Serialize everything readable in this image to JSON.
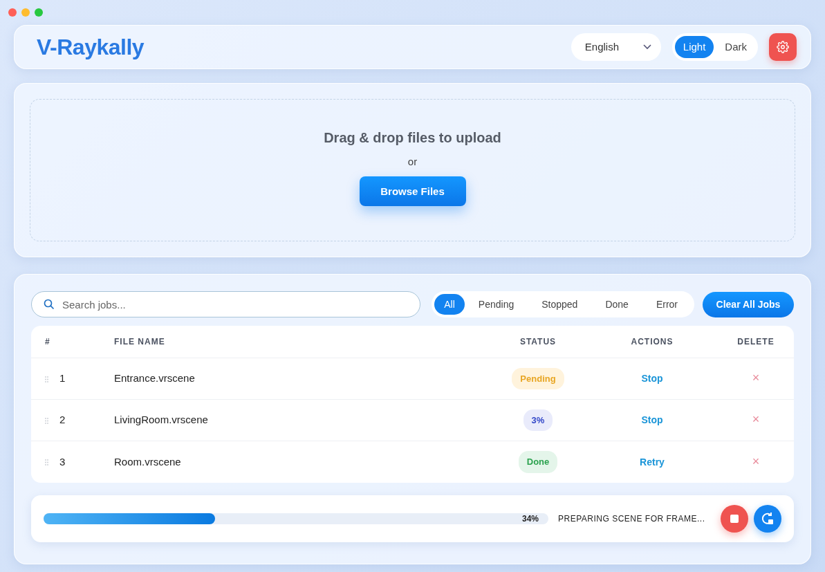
{
  "app": {
    "title": "V-Raykally"
  },
  "language": {
    "value": "English"
  },
  "theme_toggle": [
    {
      "label": "Light",
      "selected": true
    },
    {
      "label": "Dark",
      "selected": false
    }
  ],
  "upload": {
    "heading": "Drag & drop files to upload",
    "separator": "or",
    "button": "Browse Files"
  },
  "search": {
    "placeholder": "Search jobs..."
  },
  "filters": [
    {
      "label": "All",
      "selected": true
    },
    {
      "label": "Pending",
      "selected": false
    },
    {
      "label": "Stopped",
      "selected": false
    },
    {
      "label": "Done",
      "selected": false
    },
    {
      "label": "Error",
      "selected": false
    }
  ],
  "clear_button": "Clear All Jobs",
  "table": {
    "columns": [
      "#",
      "FILE NAME",
      "STATUS",
      "ACTIONS",
      "DELETE"
    ],
    "rows": [
      {
        "index": "1",
        "file": "Entrance.vrscene",
        "status": {
          "kind": "pending",
          "text": "Pending"
        },
        "action": "Stop",
        "delete": "×"
      },
      {
        "index": "2",
        "file": "LivingRoom.vrscene",
        "status": {
          "kind": "progress",
          "text": "3%"
        },
        "action": "Stop",
        "delete": "×"
      },
      {
        "index": "3",
        "file": "Room.vrscene",
        "status": {
          "kind": "done",
          "text": "Done"
        },
        "action": "Retry",
        "delete": "×"
      }
    ]
  },
  "progress": {
    "level": 0.34,
    "reading": "34%",
    "message": "PREPARING SCENE FOR FRAME..."
  }
}
